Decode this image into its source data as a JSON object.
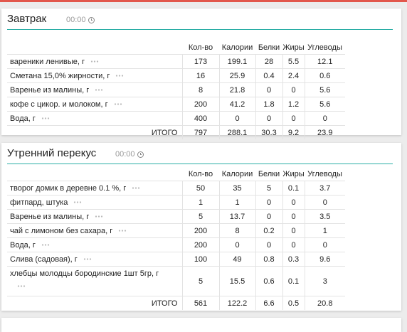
{
  "meals": [
    {
      "title": "Завтрак",
      "time": "00:00",
      "headers": [
        "Кол-во",
        "Калории",
        "Белки",
        "Жиры",
        "Углеводы"
      ],
      "rows": [
        {
          "name": "вареники ленивые, г",
          "qty": "173",
          "cal": "199.1",
          "prot": "28",
          "fat": "5.5",
          "carb": "12.1"
        },
        {
          "name": "Сметана 15,0% жирности, г",
          "qty": "16",
          "cal": "25.9",
          "prot": "0.4",
          "fat": "2.4",
          "carb": "0.6"
        },
        {
          "name": "Варенье из малины, г",
          "qty": "8",
          "cal": "21.8",
          "prot": "0",
          "fat": "0",
          "carb": "5.6"
        },
        {
          "name": "кофе с цикор. и молоком, г",
          "qty": "200",
          "cal": "41.2",
          "prot": "1.8",
          "fat": "1.2",
          "carb": "5.6"
        },
        {
          "name": "Вода, г",
          "qty": "400",
          "cal": "0",
          "prot": "0",
          "fat": "0",
          "carb": "0"
        }
      ],
      "total": {
        "label": "ИТОГО",
        "qty": "797",
        "cal": "288.1",
        "prot": "30.3",
        "fat": "9.2",
        "carb": "23.9"
      }
    },
    {
      "title": "Утренний перекус",
      "time": "00:00",
      "headers": [
        "Кол-во",
        "Калории",
        "Белки",
        "Жиры",
        "Углеводы"
      ],
      "rows": [
        {
          "name": "творог домик в деревне 0.1 %, г",
          "qty": "50",
          "cal": "35",
          "prot": "5",
          "fat": "0.1",
          "carb": "3.7"
        },
        {
          "name": "фитпард, штука",
          "qty": "1",
          "cal": "1",
          "prot": "0",
          "fat": "0",
          "carb": "0"
        },
        {
          "name": "Варенье из малины, г",
          "qty": "5",
          "cal": "13.7",
          "prot": "0",
          "fat": "0",
          "carb": "3.5"
        },
        {
          "name": "чай с лимоном без сахара, г",
          "qty": "200",
          "cal": "8",
          "prot": "0.2",
          "fat": "0",
          "carb": "1"
        },
        {
          "name": "Вода, г",
          "qty": "200",
          "cal": "0",
          "prot": "0",
          "fat": "0",
          "carb": "0"
        },
        {
          "name": "Слива (садовая), г",
          "qty": "100",
          "cal": "49",
          "prot": "0.8",
          "fat": "0.3",
          "carb": "9.6"
        },
        {
          "name": "хлебцы молодцы бородинские 1шт 5гр, г",
          "qty": "5",
          "cal": "15.5",
          "prot": "0.6",
          "fat": "0.1",
          "carb": "3"
        }
      ],
      "total": {
        "label": "ИТОГО",
        "qty": "561",
        "cal": "122.2",
        "prot": "6.6",
        "fat": "0.5",
        "carb": "20.8"
      }
    }
  ]
}
